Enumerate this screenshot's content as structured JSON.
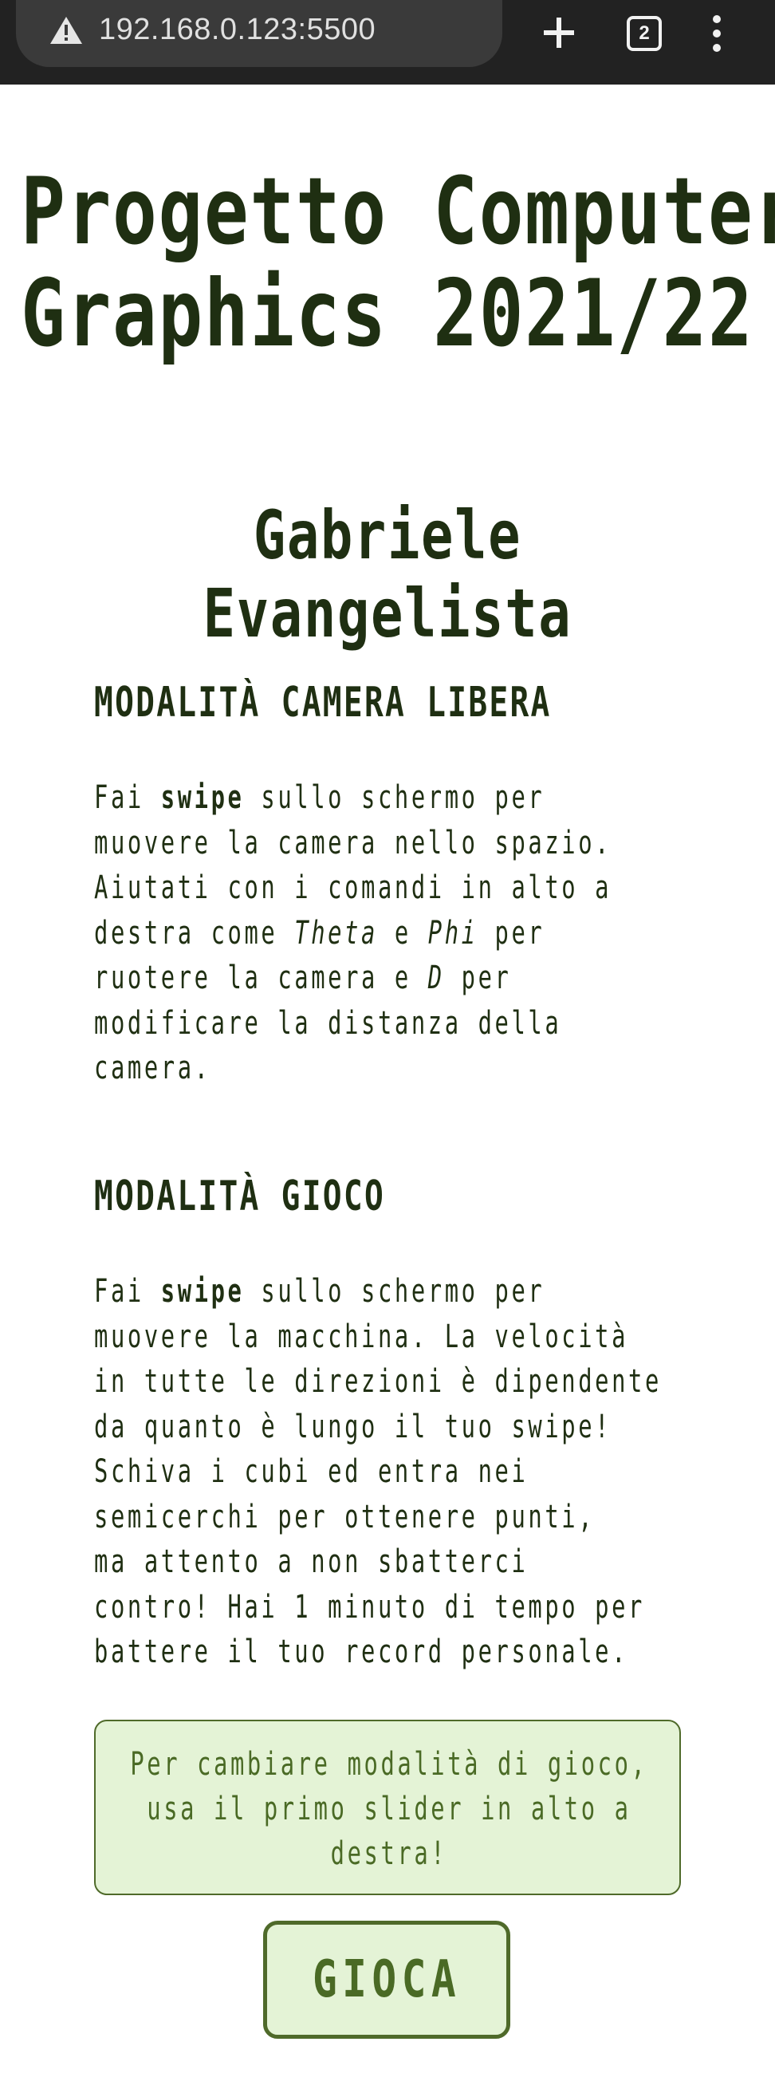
{
  "browser": {
    "url": "192.168.0.123:5500",
    "tab_count": "2",
    "icons": [
      "warning-icon",
      "plus-icon",
      "tabs-icon",
      "menu-icon"
    ]
  },
  "page": {
    "title_line1": "Progetto Computer",
    "title_line2": "Graphics 2021/22",
    "author": "Gabriele Evangelista",
    "free_camera": {
      "heading": "MODALITÀ CAMERA LIBERA",
      "lines": [
        [
          "Fai ",
          "swipe",
          " sullo schermo per"
        ],
        [
          "muovere la camera nello spazio."
        ],
        [
          "Aiutati con i comandi in alto a"
        ],
        [
          "destra come ",
          "Theta",
          " e ",
          "Phi",
          " per"
        ],
        [
          "ruotere la camera e ",
          "D",
          " per"
        ],
        [
          "modificare la distanza della"
        ],
        [
          "camera."
        ]
      ]
    },
    "game_mode": {
      "heading": "MODALITÀ GIOCO",
      "lines": [
        [
          "Fai ",
          "swipe",
          " sullo schermo per"
        ],
        [
          "muovere la macchina. La velocità"
        ],
        [
          "in tutte le direzioni è dipendente"
        ],
        [
          "da quanto è lungo il tuo swipe!"
        ],
        [
          "Schiva i cubi ed entra nei"
        ],
        [
          "semicerchi per ottenere punti,"
        ],
        [
          "ma attento a non sbatterci"
        ],
        [
          "contro! Hai 1 minuto di tempo per"
        ],
        [
          "battere il tuo record personale."
        ]
      ]
    },
    "hint": {
      "lines": [
        "Per cambiare modalità di gioco,",
        "usa il primo slider in alto a",
        "destra!"
      ]
    },
    "play_button_label": "GIOCA"
  },
  "colors": {
    "text_dark": "#1f2f12",
    "accent_green": "#4a6a25",
    "box_background": "#e4f3d6",
    "browser_bar": "#222222"
  }
}
